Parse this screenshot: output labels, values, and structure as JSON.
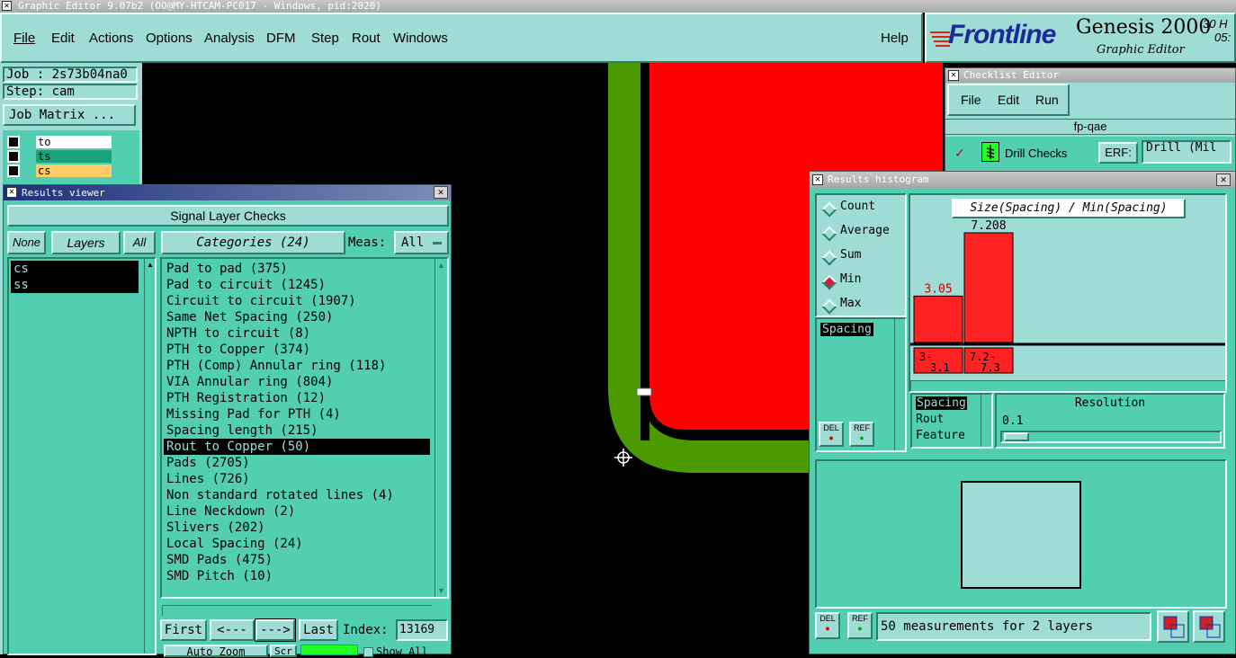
{
  "app": {
    "title": "Graphic Editor 9.07b2  (OO@MY-HTCAM-PC017 - Windows, pid:2020)",
    "menu": [
      {
        "label": "File"
      },
      {
        "label": "Edit"
      },
      {
        "label": "Actions"
      },
      {
        "label": "Options"
      },
      {
        "label": "Analysis"
      },
      {
        "label": "DFM"
      },
      {
        "label": "Step"
      },
      {
        "label": "Rout"
      },
      {
        "label": "Windows"
      }
    ],
    "help": "Help",
    "brand": "Frontline",
    "product": "Genesis 2000",
    "subtitle": "Graphic Editor",
    "clock_top": "30 H",
    "clock_bottom": "05:"
  },
  "job": {
    "job_label": "Job : 2s73b04na0",
    "step_label": "Step: cam",
    "matrix_button": "Job Matrix ...",
    "layers": [
      {
        "name": "to",
        "color": "#ffffff"
      },
      {
        "name": "ts",
        "color": "#1aa37a"
      },
      {
        "name": "cs",
        "color": "#ffcc66"
      }
    ]
  },
  "results_viewer": {
    "title": "Results viewer",
    "heading": "Signal Layer Checks",
    "none_btn": "None",
    "layers_btn": "Layers",
    "all_btn": "All",
    "categories_label": "Categories (24)",
    "meas_label": "Meas:",
    "meas_value": "All",
    "layers": [
      "cs",
      "ss"
    ],
    "categories": [
      "Pad to pad (375)",
      "Pad to circuit (1245)",
      "Circuit to circuit (1907)",
      "Same Net Spacing (250)",
      "NPTH to circuit (8)",
      "PTH to Copper (374)",
      "PTH (Comp) Annular ring (118)",
      "VIA Annular ring (804)",
      "PTH Registration (12)",
      "Missing Pad for PTH (4)",
      "Spacing length (215)",
      "Rout to Copper (50)",
      "Pads (2705)",
      "Lines (726)",
      "Non standard rotated lines (4)",
      "Line Neckdown (2)",
      "Slivers (202)",
      "Local Spacing (24)",
      "SMD Pads (475)",
      "SMD Pitch (10)"
    ],
    "selected_category": 11,
    "first_btn": "First",
    "prev_btn": "<---",
    "next_btn": "--->",
    "last_btn": "Last",
    "index_label": "Index:",
    "index_value": "13169",
    "auto_zoom": "Auto Zoom",
    "scr": "Scr",
    "show_all": "Show All"
  },
  "checklist": {
    "title": "Checklist Editor",
    "menu": [
      "File",
      "Edit",
      "Run"
    ],
    "name": "fp-qae",
    "check_name": "Drill Checks",
    "erf_label": "ERF:",
    "erf_value": "Drill (Mil"
  },
  "histogram": {
    "title": "Results histogram",
    "modes": [
      {
        "label": "Count",
        "selected": false
      },
      {
        "label": "Average",
        "selected": false
      },
      {
        "label": "Sum",
        "selected": false
      },
      {
        "label": "Min",
        "selected": true
      },
      {
        "label": "Max",
        "selected": false
      }
    ],
    "measure_list": [
      "Spacing"
    ],
    "chart_title": "Size(Spacing) / Min(Spacing)",
    "bars": [
      {
        "value_label": "3.05",
        "range_top": "3-",
        "range_bottom": "3.1",
        "value": 3.05
      },
      {
        "value_label": "7.208",
        "range_top": "7.2-",
        "range_bottom": "7.3",
        "value": 7.208
      }
    ],
    "attr_list": [
      "Spacing",
      "Rout",
      "Feature"
    ],
    "resolution_label": "Resolution",
    "resolution_value": "0.1",
    "del_label": "DEL",
    "ref_label": "REF",
    "status": "50 measurements for 2 layers"
  }
}
